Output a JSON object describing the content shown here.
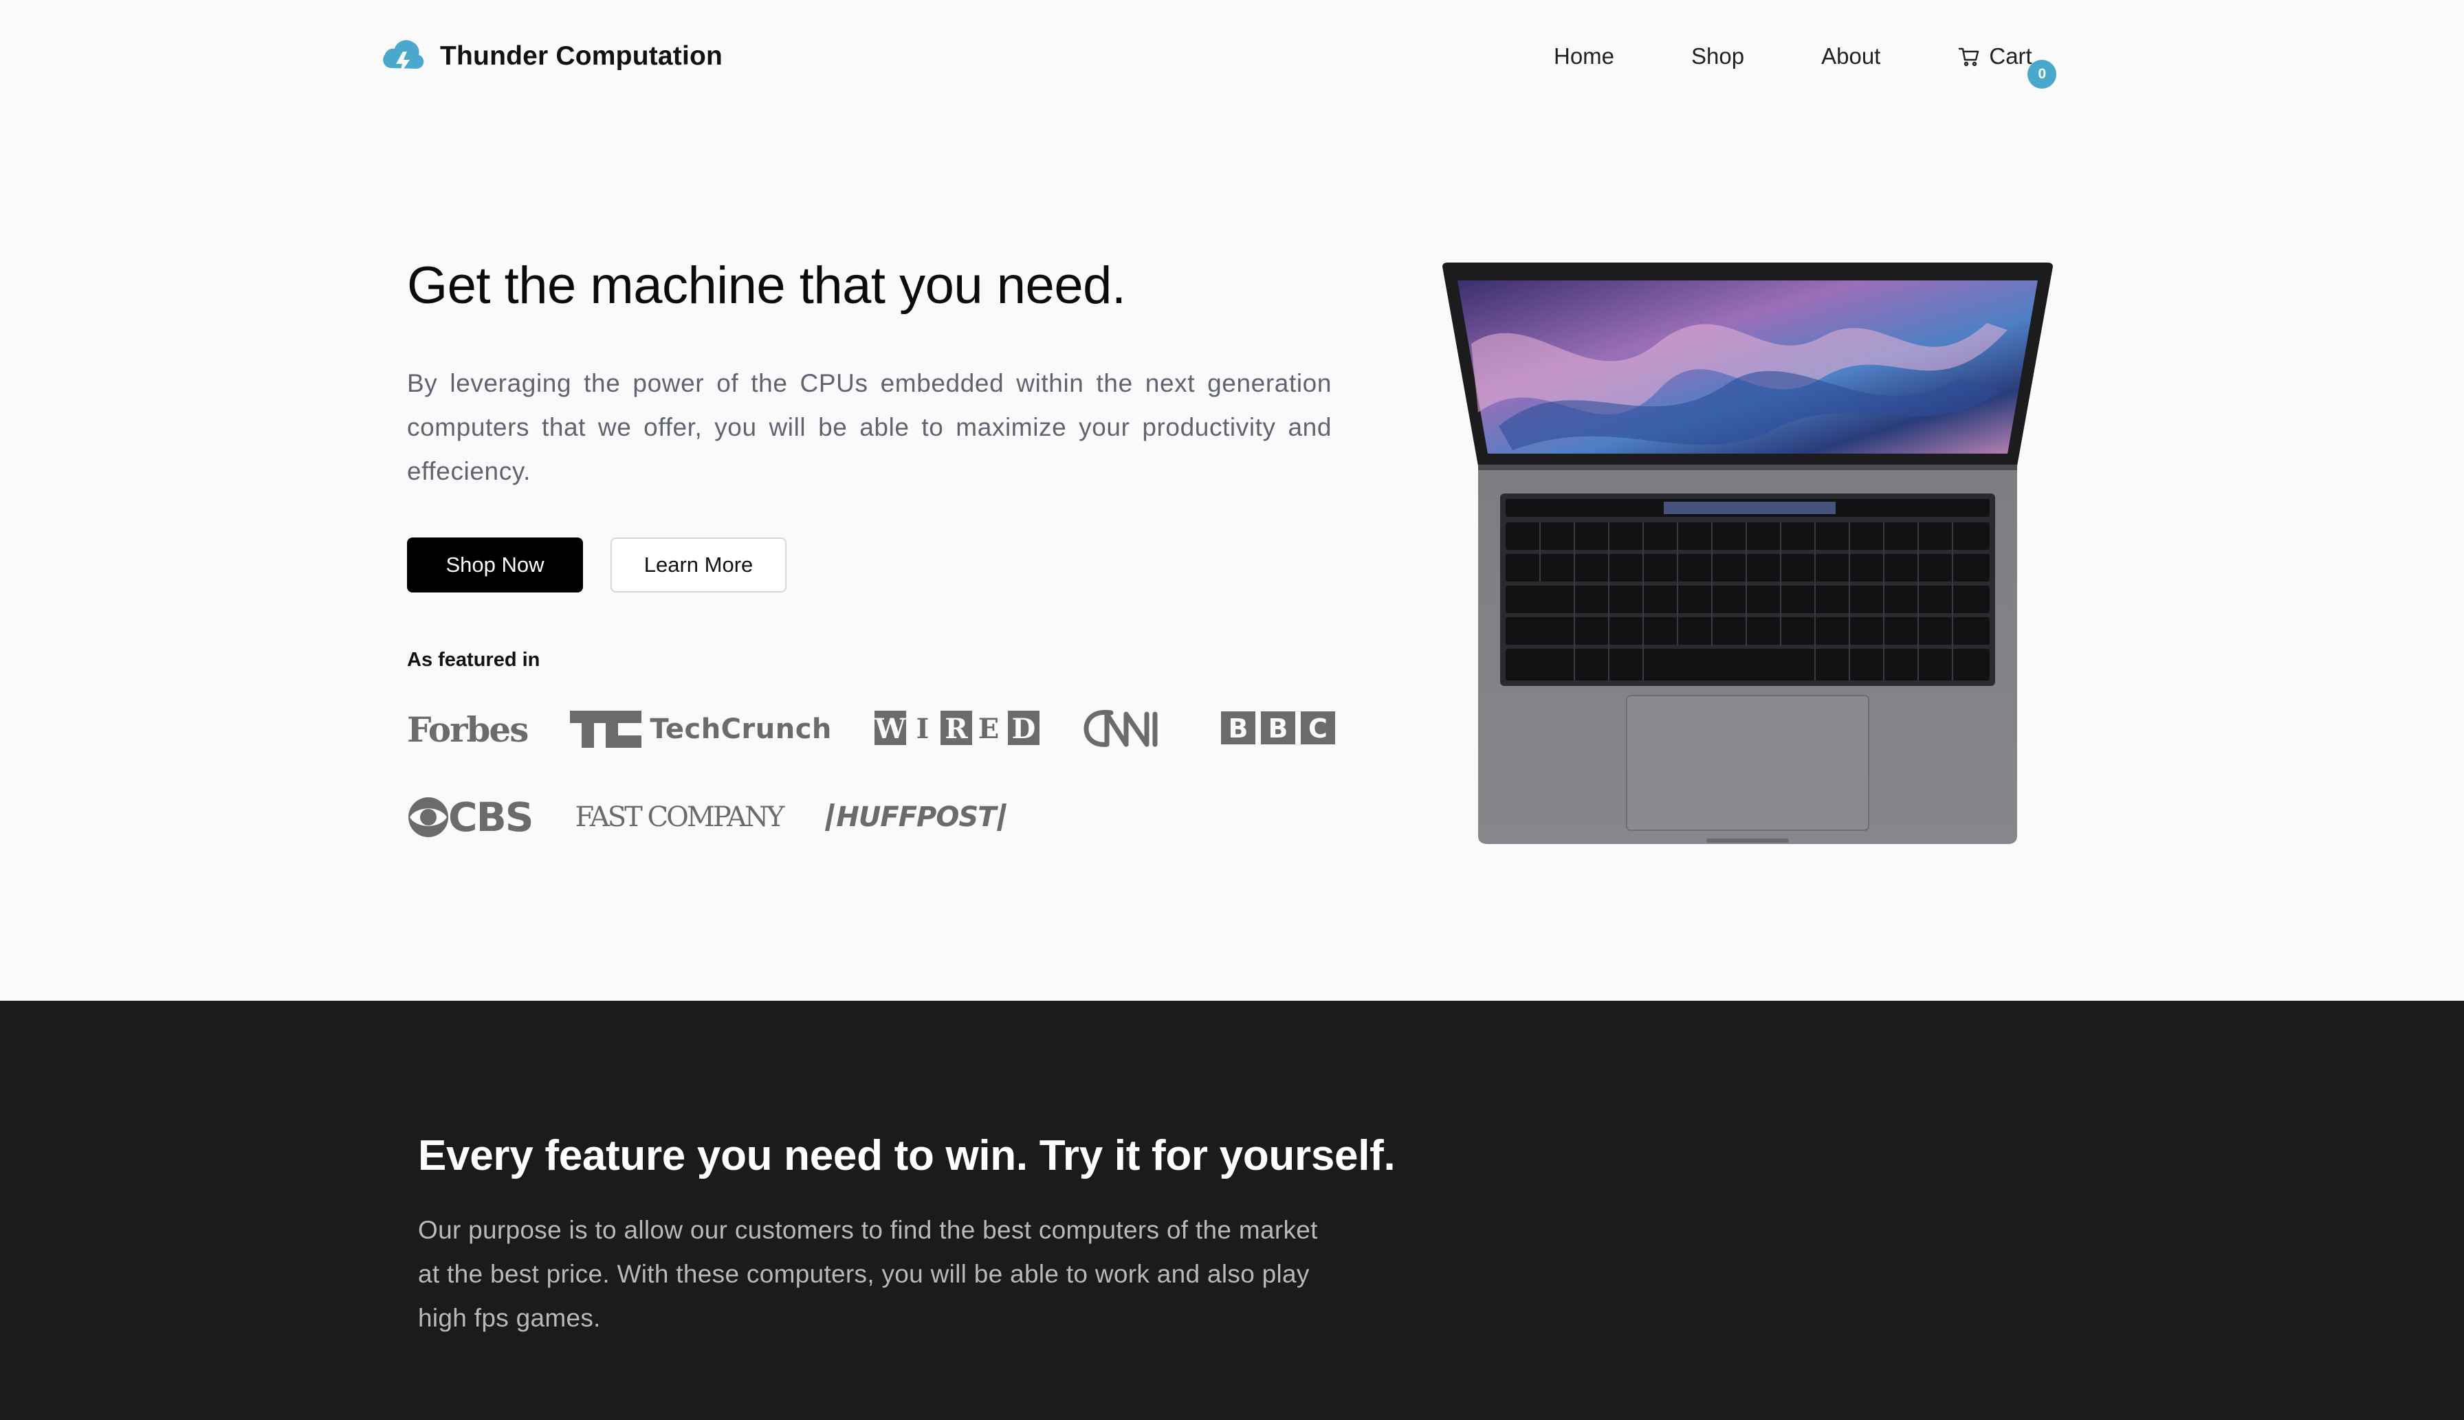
{
  "brand": {
    "name": "Thunder Computation",
    "accent_color": "#4ba8cd",
    "logo_icon": "thunder-cloud-icon"
  },
  "nav": {
    "items": [
      {
        "label": "Home"
      },
      {
        "label": "Shop"
      },
      {
        "label": "About"
      }
    ],
    "cart": {
      "label": "Cart",
      "count": "0",
      "icon": "cart-icon"
    }
  },
  "hero": {
    "title": "Get the machine that you need.",
    "description": "By leveraging the power of the CPUs embedded within the next generation computers that we offer, you will be able to maximize your productivity and effeciency.",
    "primary_button": "Shop Now",
    "secondary_button": "Learn More",
    "featured_label": "As featured in",
    "featured_logos": [
      {
        "name": "Forbes"
      },
      {
        "name": "TechCrunch"
      },
      {
        "name": "WIRED"
      },
      {
        "name": "CNN"
      },
      {
        "name": "BBC"
      },
      {
        "name": "CBS"
      },
      {
        "name": "FAST COMPANY"
      },
      {
        "name": "HUFFPOST"
      }
    ],
    "product_image": "laptop-image"
  },
  "features": {
    "title": "Every feature you need to win. Try it for yourself.",
    "description": "Our purpose is to allow our customers to find the best computers of the market at the best price. With these computers, you will be able to work and also play high fps games.",
    "background_color": "#1b1b1b"
  }
}
